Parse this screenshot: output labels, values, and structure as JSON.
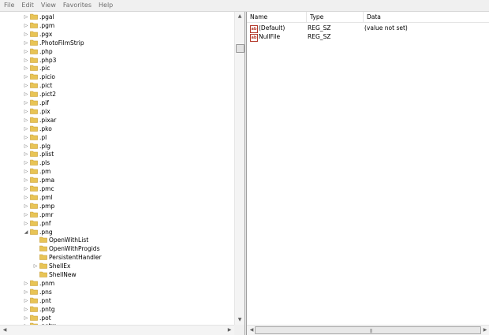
{
  "menu": [
    "File",
    "Edit",
    "View",
    "Favorites",
    "Help"
  ],
  "tree": [
    {
      "label": ".pgal",
      "level": 1,
      "arrow": "collapsed"
    },
    {
      "label": ".pgm",
      "level": 1,
      "arrow": "collapsed"
    },
    {
      "label": ".pgx",
      "level": 1,
      "arrow": "collapsed"
    },
    {
      "label": ".PhotoFilmStrip",
      "level": 1,
      "arrow": "collapsed"
    },
    {
      "label": ".php",
      "level": 1,
      "arrow": "collapsed"
    },
    {
      "label": ".php3",
      "level": 1,
      "arrow": "collapsed"
    },
    {
      "label": ".pic",
      "level": 1,
      "arrow": "collapsed"
    },
    {
      "label": ".picio",
      "level": 1,
      "arrow": "collapsed"
    },
    {
      "label": ".pict",
      "level": 1,
      "arrow": "collapsed"
    },
    {
      "label": ".pict2",
      "level": 1,
      "arrow": "collapsed"
    },
    {
      "label": ".pif",
      "level": 1,
      "arrow": "collapsed"
    },
    {
      "label": ".pix",
      "level": 1,
      "arrow": "collapsed"
    },
    {
      "label": ".pixar",
      "level": 1,
      "arrow": "collapsed"
    },
    {
      "label": ".pko",
      "level": 1,
      "arrow": "collapsed"
    },
    {
      "label": ".pl",
      "level": 1,
      "arrow": "collapsed"
    },
    {
      "label": ".plg",
      "level": 1,
      "arrow": "collapsed"
    },
    {
      "label": ".plist",
      "level": 1,
      "arrow": "collapsed"
    },
    {
      "label": ".pls",
      "level": 1,
      "arrow": "collapsed"
    },
    {
      "label": ".pm",
      "level": 1,
      "arrow": "collapsed"
    },
    {
      "label": ".pma",
      "level": 1,
      "arrow": "collapsed"
    },
    {
      "label": ".pmc",
      "level": 1,
      "arrow": "collapsed"
    },
    {
      "label": ".pml",
      "level": 1,
      "arrow": "collapsed"
    },
    {
      "label": ".pmp",
      "level": 1,
      "arrow": "collapsed"
    },
    {
      "label": ".pmr",
      "level": 1,
      "arrow": "collapsed"
    },
    {
      "label": ".pnf",
      "level": 1,
      "arrow": "collapsed"
    },
    {
      "label": ".png",
      "level": 1,
      "arrow": "expanded"
    },
    {
      "label": "OpenWithList",
      "level": 2,
      "arrow": "none"
    },
    {
      "label": "OpenWithProgids",
      "level": 2,
      "arrow": "none"
    },
    {
      "label": "PersistentHandler",
      "level": 2,
      "arrow": "none"
    },
    {
      "label": "ShellEx",
      "level": 2,
      "arrow": "collapsed"
    },
    {
      "label": "ShellNew",
      "level": 2,
      "arrow": "none"
    },
    {
      "label": ".pnm",
      "level": 1,
      "arrow": "collapsed"
    },
    {
      "label": ".pns",
      "level": 1,
      "arrow": "collapsed"
    },
    {
      "label": ".pnt",
      "level": 1,
      "arrow": "collapsed"
    },
    {
      "label": ".pntg",
      "level": 1,
      "arrow": "collapsed"
    },
    {
      "label": ".pot",
      "level": 1,
      "arrow": "collapsed"
    },
    {
      "label": ".potm",
      "level": 1,
      "arrow": "collapsed"
    }
  ],
  "columns": {
    "name": "Name",
    "type": "Type",
    "data": "Data"
  },
  "values": [
    {
      "name": "(Default)",
      "type": "REG_SZ",
      "data": "(value not set)",
      "icon": "ab-string-icon"
    },
    {
      "name": "NullFile",
      "type": "REG_SZ",
      "data": "",
      "icon": "ab-string-icon"
    }
  ],
  "icon_text": "ab",
  "scroll_glyphs": {
    "up": "▲",
    "down": "▼",
    "left": "◀",
    "right": "▶",
    "grip": "|||"
  },
  "tree_glyphs": {
    "collapsed": "▷",
    "expanded": "◢"
  },
  "colors": {
    "folder": "#e8c456",
    "folder_edge": "#c79a2a",
    "value_icon": "#b43a2c"
  }
}
